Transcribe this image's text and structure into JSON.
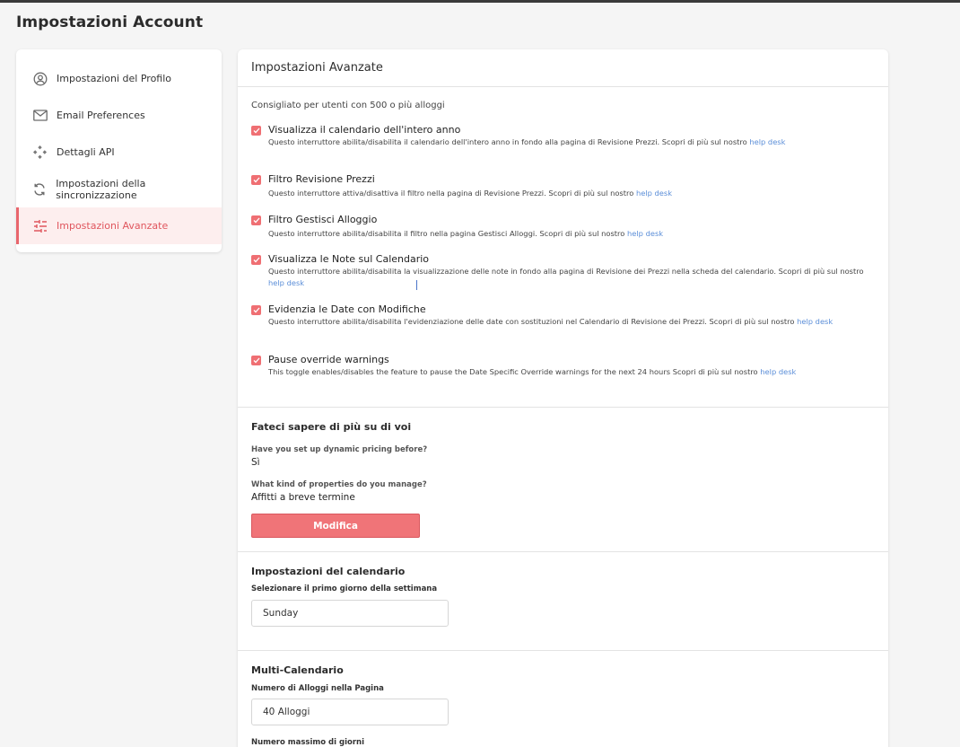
{
  "page": {
    "title": "Impostazioni Account"
  },
  "sidebar": {
    "items": [
      {
        "label": "Impostazioni del Profilo",
        "icon": "user-circle-icon"
      },
      {
        "label": "Email Preferences",
        "icon": "mail-icon"
      },
      {
        "label": "Dettagli API",
        "icon": "api-icon"
      },
      {
        "label": "Impostazioni della sincronizzazione",
        "icon": "sync-icon"
      },
      {
        "label": "Impostazioni Avanzate",
        "icon": "sliders-icon",
        "active": true
      }
    ]
  },
  "main": {
    "title": "Impostazioni Avanzate",
    "recommend": "Consigliato per utenti con 500 o più alloggi",
    "options": [
      {
        "title": "Visualizza il calendario dell'intero anno",
        "desc": "Questo interruttore abilita/disabilita il calendario dell'intero anno in fondo alla pagina di Revisione Prezzi. Scopri di più sul nostro ",
        "link": "help desk",
        "checked": true
      },
      {
        "title": "Filtro Revisione Prezzi",
        "desc": "Questo interruttore attiva/disattiva il filtro nella pagina di Revisione Prezzi. Scopri di più sul nostro ",
        "link": "help desk",
        "checked": true
      },
      {
        "title": "Filtro Gestisci Alloggio",
        "desc": "Questo interruttore abilita/disabilita il filtro nella pagina Gestisci Alloggi. Scopri di più sul nostro ",
        "link": "help desk",
        "checked": true
      },
      {
        "title": "Visualizza le Note sul Calendario",
        "desc": "Questo interruttore abilita/disabilita la visualizzazione delle note in fondo alla pagina di Revisione dei Prezzi nella scheda del calendario. Scopri di più sul nostro ",
        "link": "help desk",
        "checked": true
      },
      {
        "title": "Evidenzia le Date con Modifiche",
        "desc": "Questo interruttore abilita/disabilita l'evidenziazione delle date con sostituzioni nel Calendario di Revisione dei Prezzi. Scopri di più sul nostro ",
        "link": "help desk",
        "checked": true
      },
      {
        "title": "Pause override warnings",
        "desc": "This toggle enables/disables the feature to pause the Date Specific Override warnings for the next 24 hours Scopri di più sul nostro ",
        "link": "help desk",
        "checked": true
      }
    ]
  },
  "about": {
    "title": "Fateci sapere di più su di voi",
    "q1": "Have you set up dynamic pricing before?",
    "a1": "Sì",
    "q2": "What kind of properties do you manage?",
    "a2": "Affitti a breve termine",
    "button": "Modifica"
  },
  "calendar": {
    "title": "Impostazioni del calendario",
    "label": "Selezionare il primo giorno della settimana",
    "value": "Sunday"
  },
  "multi": {
    "title": "Multi-Calendario",
    "label": "Numero di Alloggi nella Pagina",
    "value": "40 Alloggi",
    "label2": "Numero massimo di giorni"
  },
  "colors": {
    "accent": "#ef6f73",
    "link": "#5b8ed8",
    "active_bg": "#fdeeee"
  }
}
